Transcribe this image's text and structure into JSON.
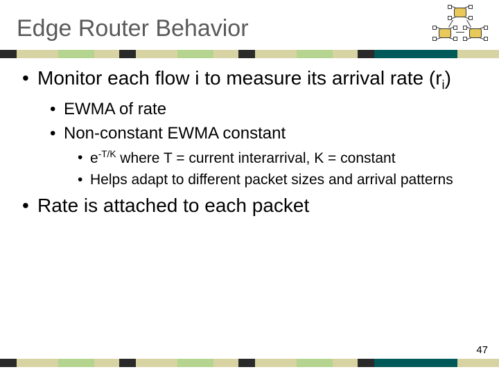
{
  "title": "Edge Router Behavior",
  "page_number": "47",
  "stripe_colors": [
    "#2a2a2a",
    "#d8d3a2",
    "#b4d48f",
    "#d8d3a2",
    "#2a2a2a",
    "#d8d3a2",
    "#b4d48f",
    "#d8d3a2",
    "#2a2a2a",
    "#d8d3a2",
    "#b4d48f",
    "#d8d3a2",
    "#2a2a2a",
    "#005a5a",
    "#d8d3a2"
  ],
  "stripe_widths": [
    24,
    60,
    52,
    36,
    24,
    60,
    52,
    36,
    24,
    60,
    52,
    36,
    24,
    120,
    60
  ],
  "bullets": {
    "b1_pre": "Monitor each flow i to measure its arrival rate (r",
    "b1_sub": "i",
    "b1_post": ")",
    "b1a": "EWMA of rate",
    "b1b": "Non-constant EWMA constant",
    "b1b1_pre": "e",
    "b1b1_sup": "-T/K",
    "b1b1_post": " where T = current interarrival, K = constant",
    "b1b2": "Helps adapt to different packet sizes and arrival patterns",
    "b2": "Rate is attached to each packet"
  }
}
